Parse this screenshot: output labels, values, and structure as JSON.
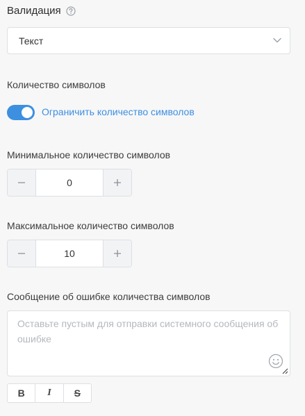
{
  "validation": {
    "title": "Валидация",
    "help_icon": "question-circle-icon",
    "select_value": "Текст"
  },
  "char_count": {
    "section_label": "Количество символов",
    "toggle_label": "Ограничить количество символов",
    "toggle_on": true,
    "accent_color": "#3d8fe0"
  },
  "min_chars": {
    "label": "Минимальное количество символов",
    "value": "0"
  },
  "max_chars": {
    "label": "Максимальное количество символов",
    "value": "10"
  },
  "error_message": {
    "label": "Сообщение об ошибке количества символов",
    "placeholder": "Оставьте пустым для отправки системного сообщения об ошибке",
    "value": ""
  },
  "formatting": {
    "bold": "B",
    "italic": "I",
    "strike": "S"
  }
}
